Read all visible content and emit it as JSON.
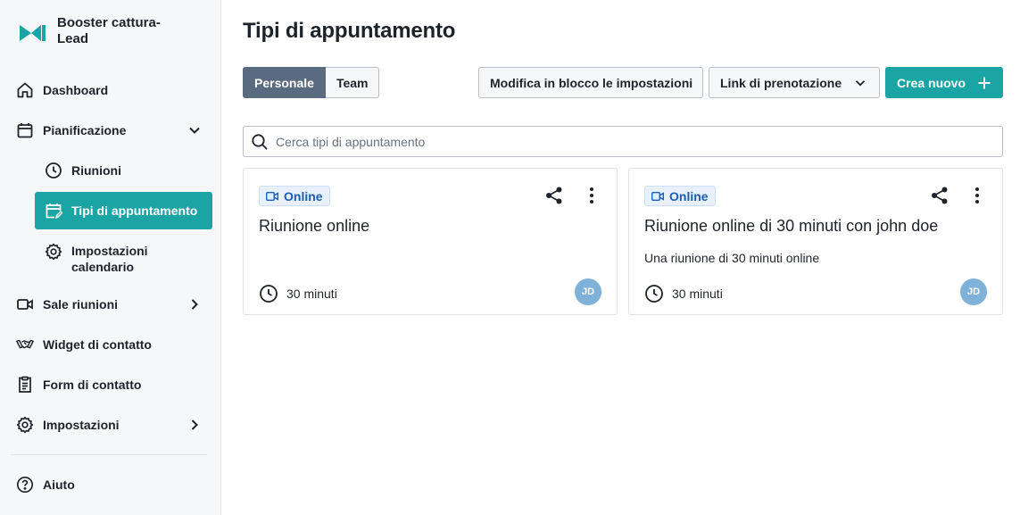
{
  "brand": {
    "name": "Booster cattura-Lead",
    "logo_color": "#1ba4a4"
  },
  "sidebar": {
    "items": [
      {
        "label": "Dashboard",
        "icon": "home-icon"
      },
      {
        "label": "Pianificazione",
        "icon": "calendar-icon",
        "expanded": true
      },
      {
        "label": "Riunioni",
        "icon": "clock-icon"
      },
      {
        "label": "Tipi di appuntamento",
        "icon": "calendar-edit-icon",
        "active": true
      },
      {
        "label": "Impostazioni calendario",
        "icon": "gear-icon"
      },
      {
        "label": "Sale riunioni",
        "icon": "video-icon"
      },
      {
        "label": "Widget di contatto",
        "icon": "handshake-icon"
      },
      {
        "label": "Form di contatto",
        "icon": "form-icon"
      },
      {
        "label": "Impostazioni",
        "icon": "gear-icon"
      },
      {
        "label": "Aiuto",
        "icon": "help-icon"
      }
    ]
  },
  "main": {
    "title": "Tipi di appuntamento",
    "tabs": [
      {
        "label": "Personale",
        "active": true
      },
      {
        "label": "Team",
        "active": false
      }
    ],
    "actions": {
      "bulk_edit": "Modifica in blocco le impostazioni",
      "booking_link": "Link di prenotazione",
      "create_new": "Crea nuovo"
    },
    "search": {
      "placeholder": "Cerca tipi di appuntamento",
      "value": ""
    },
    "cards": [
      {
        "badge": "Online",
        "title": "Riunione online",
        "description": "",
        "duration": "30 minuti",
        "avatar": "JD"
      },
      {
        "badge": "Online",
        "title": "Riunione online di 30 minuti con john doe",
        "description": "Una riunione di 30 minuti online",
        "duration": "30 minuti",
        "avatar": "JD"
      }
    ]
  },
  "colors": {
    "accent": "#1ba4a4",
    "active_tab": "#5a6a7f",
    "badge_text": "#1d5fb4",
    "avatar_bg": "#7fb2d8"
  }
}
